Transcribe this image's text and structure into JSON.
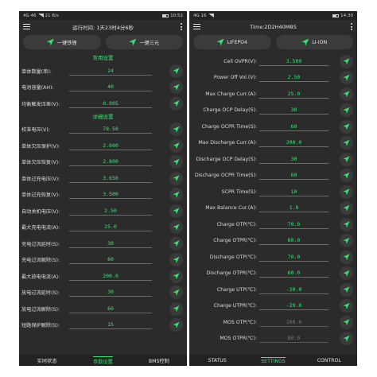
{
  "left": {
    "status": {
      "carrier": "4G 46",
      "speed": "21 B/s",
      "time": "10:52"
    },
    "title": "运行时间: 1天23时4分6秒",
    "modes": [
      "一键铁锂",
      "一键三元"
    ],
    "sections": [
      {
        "title": "常用设置",
        "rows": [
          {
            "label": "单体数量(串):",
            "value": "24"
          },
          {
            "label": "电池容量(AH):",
            "value": "40"
          },
          {
            "label": "均衡触发压差(V):",
            "value": "0.005"
          }
        ]
      },
      {
        "title": "详细设置",
        "rows": [
          {
            "label": "校准电压(V):",
            "value": "78.50"
          },
          {
            "label": "单体欠压保护(V):",
            "value": "2.600"
          },
          {
            "label": "单体欠压恢复(V):",
            "value": "2.800"
          },
          {
            "label": "单体过充电压(V):",
            "value": "3.650"
          },
          {
            "label": "单体过充恢复(V):",
            "value": "3.500"
          },
          {
            "label": "自动关机电压(V):",
            "value": "2.50"
          },
          {
            "label": "最大充电电流(A):",
            "value": "25.0"
          },
          {
            "label": "充电过流延时(S):",
            "value": "30"
          },
          {
            "label": "充电过流解除(S):",
            "value": "60"
          },
          {
            "label": "最大放电电流(A):",
            "value": "200.0"
          },
          {
            "label": "放电过流延时(S):",
            "value": "30"
          },
          {
            "label": "放电过流解除(S):",
            "value": "60"
          },
          {
            "label": "短路保护解除(S):",
            "value": "15"
          }
        ]
      }
    ],
    "nav": [
      "实时状态",
      "参数设置",
      "BMS控制"
    ],
    "active_nav": 1
  },
  "right": {
    "status": {
      "carrier": "4G 16",
      "speed": "",
      "time": "14:30"
    },
    "title": "Time:2D2H40M8S",
    "modes": [
      "LIFEPO4",
      "LI-ION"
    ],
    "rows": [
      {
        "label": "Cell OVPR(V):",
        "value": "3.500",
        "disabled": false
      },
      {
        "label": "Power Off Vol.(V):",
        "value": "2.50",
        "disabled": false
      },
      {
        "label": "Max Charge Curr.(A):",
        "value": "25.0",
        "disabled": false
      },
      {
        "label": "Charge OCP Delay(S):",
        "value": "30",
        "disabled": false
      },
      {
        "label": "Charge OCPR Time(S):",
        "value": "60",
        "disabled": false
      },
      {
        "label": "Max Discharge Curr.(A):",
        "value": "200.0",
        "disabled": false
      },
      {
        "label": "Discharge OCP Delay(S):",
        "value": "30",
        "disabled": false
      },
      {
        "label": "Discharge OCPR Time(S):",
        "value": "60",
        "disabled": false
      },
      {
        "label": "SCPR Time(S):",
        "value": "10",
        "disabled": false
      },
      {
        "label": "Max Balance Cur.(A):",
        "value": "1.0",
        "disabled": false
      },
      {
        "label": "Charge OTP(℃):",
        "value": "70.0",
        "disabled": false
      },
      {
        "label": "Charge OTPR(℃):",
        "value": "60.0",
        "disabled": false
      },
      {
        "label": "Discharge OTP(℃):",
        "value": "70.0",
        "disabled": false
      },
      {
        "label": "Discharge OTPR(℃):",
        "value": "60.0",
        "disabled": false
      },
      {
        "label": "Charge UTP(℃):",
        "value": "-30.0",
        "disabled": false
      },
      {
        "label": "Charge UTPR(℃):",
        "value": "-20.0",
        "disabled": false
      },
      {
        "label": "MOS OTP(℃):",
        "value": "100.0",
        "disabled": true
      },
      {
        "label": "MOS OTPR(℃):",
        "value": "80.0",
        "disabled": true
      }
    ],
    "nav": [
      "STATUS",
      "SETTINGS",
      "CONTROL"
    ],
    "active_nav": 1
  },
  "colors": {
    "accent": "#3fe07a",
    "background": "#2b2b2b",
    "button": "#3a3a3a"
  }
}
